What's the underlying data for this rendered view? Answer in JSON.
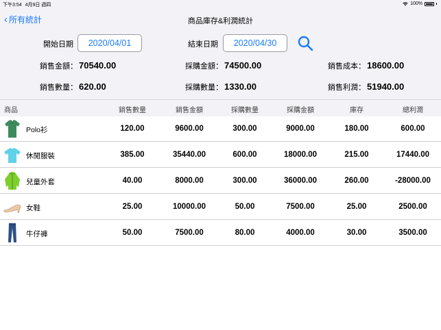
{
  "status": {
    "time": "下午3:54",
    "date": "4月9日 週四",
    "battery": "100%"
  },
  "nav": {
    "back_label": "所有統計",
    "title": "商品庫存&利潤統計"
  },
  "filters": {
    "start_label": "開始日期",
    "start_value": "2020/04/01",
    "end_label": "結束日期",
    "end_value": "2020/04/30"
  },
  "summary": {
    "sales_amount_label": "銷售金額：",
    "sales_amount": "70540.00",
    "purchase_amount_label": "採購金額：",
    "purchase_amount": "74500.00",
    "sales_cost_label": "銷售成本：",
    "sales_cost": "18600.00",
    "sales_qty_label": "銷售數量：",
    "sales_qty": "620.00",
    "purchase_qty_label": "採購數量：",
    "purchase_qty": "1330.00",
    "sales_profit_label": "銷售利潤：",
    "sales_profit": "51940.00"
  },
  "table": {
    "headers": [
      "商品",
      "銷售數量",
      "銷售金額",
      "採購數量",
      "採購金額",
      "庫存",
      "總利潤"
    ],
    "rows": [
      {
        "name": "Polo衫",
        "icon": "polo-shirt-icon",
        "cells": [
          "120.00",
          "9600.00",
          "300.00",
          "9000.00",
          "180.00",
          "600.00"
        ]
      },
      {
        "name": "休閒服裝",
        "icon": "tshirt-icon",
        "cells": [
          "385.00",
          "35440.00",
          "600.00",
          "18000.00",
          "215.00",
          "17440.00"
        ]
      },
      {
        "name": "兒童外套",
        "icon": "jacket-icon",
        "cells": [
          "40.00",
          "8000.00",
          "300.00",
          "36000.00",
          "260.00",
          "-28000.00"
        ]
      },
      {
        "name": "女鞋",
        "icon": "heel-shoe-icon",
        "cells": [
          "25.00",
          "10000.00",
          "50.00",
          "7500.00",
          "25.00",
          "2500.00"
        ]
      },
      {
        "name": "牛仔褲",
        "icon": "jeans-icon",
        "cells": [
          "50.00",
          "7500.00",
          "80.00",
          "4000.00",
          "30.00",
          "3500.00"
        ]
      }
    ]
  },
  "colors": {
    "accent": "#1a7af8",
    "panel": "#f2f2f7"
  }
}
